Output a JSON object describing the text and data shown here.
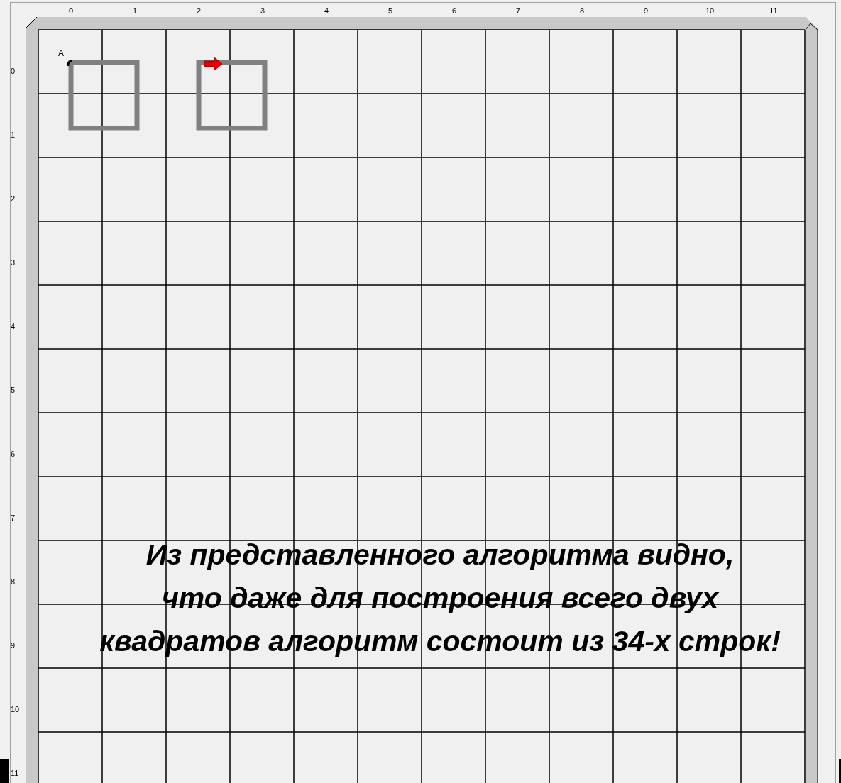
{
  "canvas": {
    "column_labels": [
      "0",
      "1",
      "2",
      "3",
      "4",
      "5",
      "6",
      "7",
      "8",
      "9",
      "10",
      "11"
    ],
    "row_labels": [
      "0",
      "1",
      "2",
      "3",
      "4",
      "5",
      "6",
      "7",
      "8",
      "9",
      "10",
      "11"
    ],
    "start_point_label": "A"
  },
  "caption": {
    "lines": [
      "Из представленного алгоритма видно,",
      "что даже для построения всего двух",
      "квадратов алгоритм состоит из 34-х строк!"
    ]
  }
}
